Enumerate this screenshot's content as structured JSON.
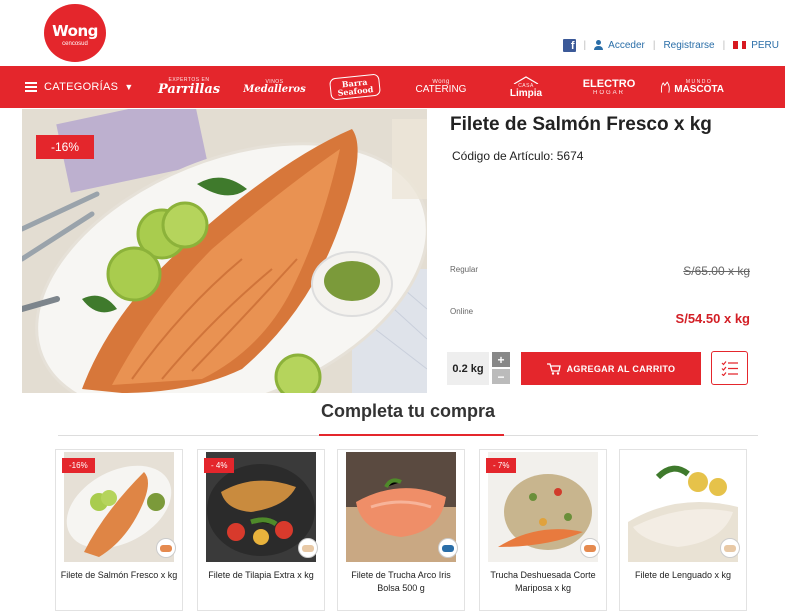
{
  "header": {
    "logo_text": "Wong",
    "logo_sub": "cencosud",
    "acceder": "Acceder",
    "registrarse": "Registrarse",
    "country": "PERU",
    "facebook": "f"
  },
  "nav": {
    "categorias": "CATEGORÍAS",
    "items": [
      {
        "small": "EXPERTOS EN",
        "big": "Parrillas"
      },
      {
        "small": "VINOS",
        "big": "Medalleros"
      },
      {
        "small": "",
        "big": "Barra Seafood"
      },
      {
        "small": "Wong",
        "big": "CATERING"
      },
      {
        "small": "CASA",
        "big": "Limpia"
      },
      {
        "small": "ELECTRO",
        "big": "HOGAR"
      },
      {
        "small": "MUNDO",
        "big": "MASCOTA"
      }
    ]
  },
  "product": {
    "title": "Filete de Salmón Fresco x kg",
    "code": "Código de Artículo: 5674",
    "discount": "-16%",
    "regular_label": "Regular",
    "regular_price": "S/65.00 x kg",
    "online_label": "Online",
    "online_price": "S/54.50 x kg",
    "quantity": "0.2 kg",
    "plus": "+",
    "minus": "−",
    "add_to_cart": "AGREGAR AL CARRITO"
  },
  "related": {
    "title": "Completa tu compra",
    "items": [
      {
        "name": "Filete de Salmón Fresco x kg",
        "discount": "-16%"
      },
      {
        "name": "Filete de Tilapia Extra x kg",
        "discount": "- 4%"
      },
      {
        "name": "Filete de Trucha Arco Iris Bolsa 500 g",
        "discount": ""
      },
      {
        "name": "Trucha Deshuesada Corte Mariposa x kg",
        "discount": "- 7%"
      },
      {
        "name": "Filete de Lenguado x kg",
        "discount": ""
      }
    ]
  },
  "colors": {
    "brand_red": "#e4262c",
    "price_red": "#d31f26",
    "link_blue": "#2a6ea8"
  }
}
